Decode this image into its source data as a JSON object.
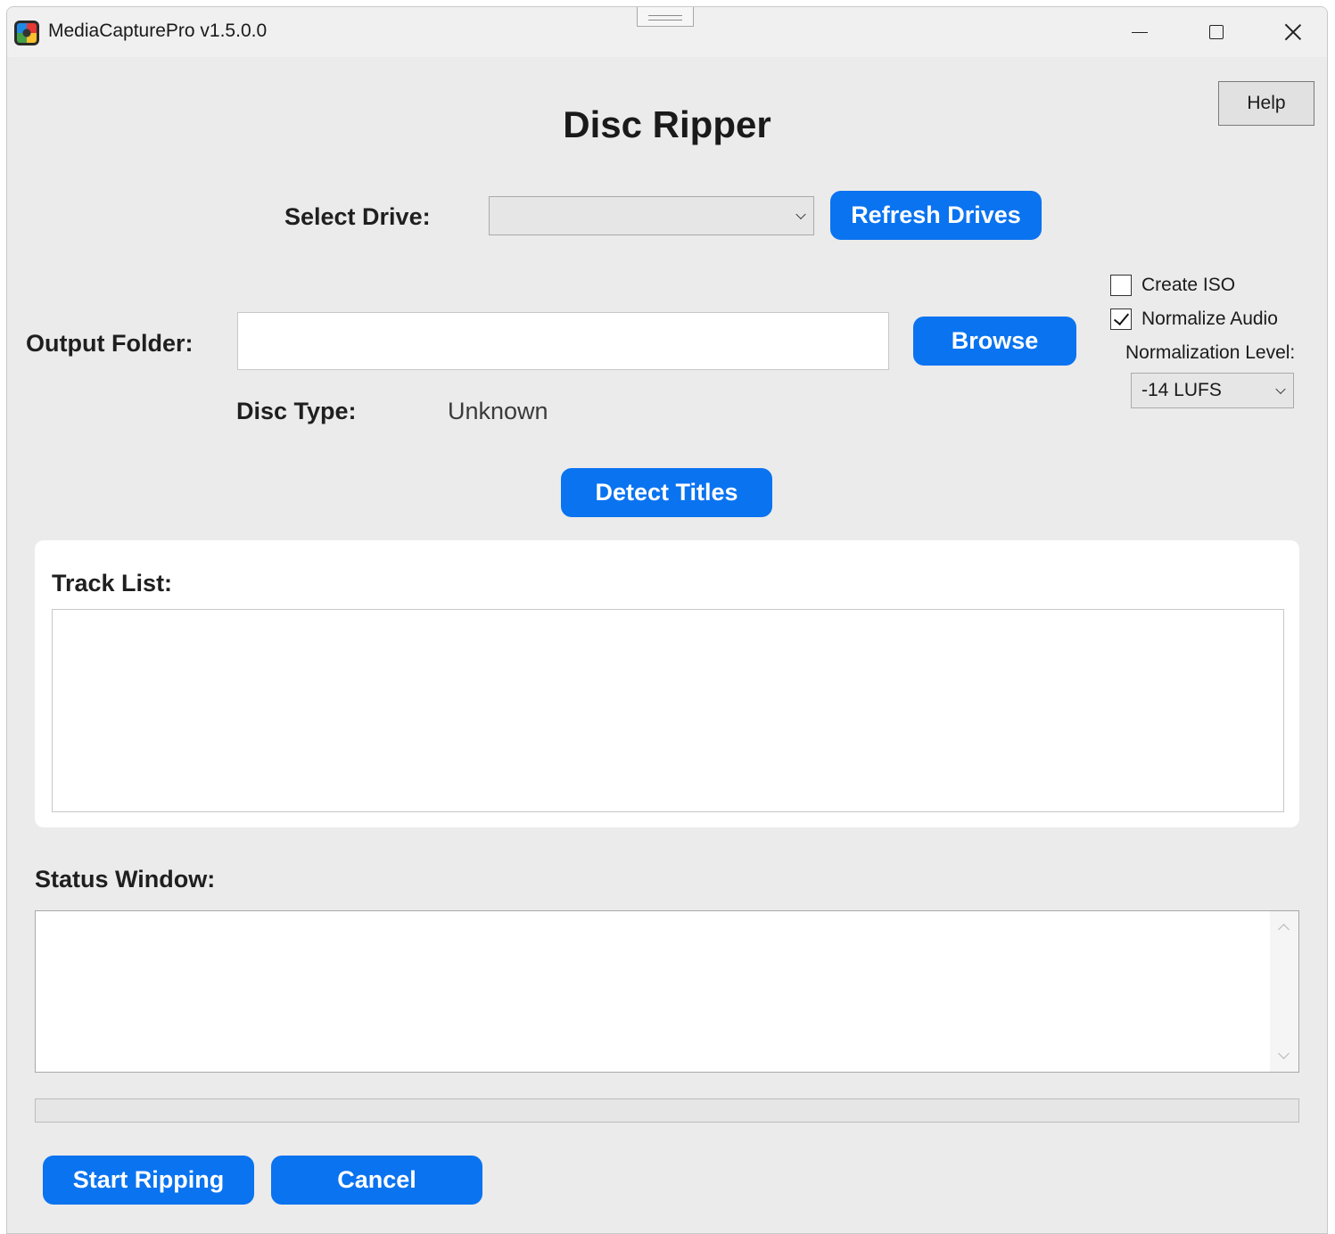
{
  "window": {
    "title": "MediaCapturePro v1.5.0.0",
    "controls": [
      "minimize-icon",
      "maximize-icon",
      "close-icon"
    ]
  },
  "header": {
    "help_label": "Help",
    "page_title": "Disc Ripper"
  },
  "drive": {
    "label": "Select Drive:",
    "selected": "",
    "refresh_label": "Refresh Drives"
  },
  "output": {
    "label": "Output Folder:",
    "value": "",
    "browse_label": "Browse"
  },
  "options": {
    "create_iso_label": "Create ISO",
    "create_iso_checked": false,
    "normalize_audio_label": "Normalize Audio",
    "normalize_audio_checked": true,
    "normalization_level_label": "Normalization Level:",
    "normalization_level_value": "-14 LUFS"
  },
  "disc": {
    "type_label": "Disc Type:",
    "type_value": "Unknown"
  },
  "detect_titles_label": "Detect Titles",
  "track_list": {
    "label": "Track List:",
    "items": []
  },
  "status": {
    "label": "Status Window:",
    "text": "",
    "progress": 0
  },
  "actions": {
    "start_label": "Start Ripping",
    "cancel_label": "Cancel"
  },
  "colors": {
    "accent": "#0a73f0",
    "window_bg": "#ebebeb",
    "panel_bg": "#ffffff"
  }
}
